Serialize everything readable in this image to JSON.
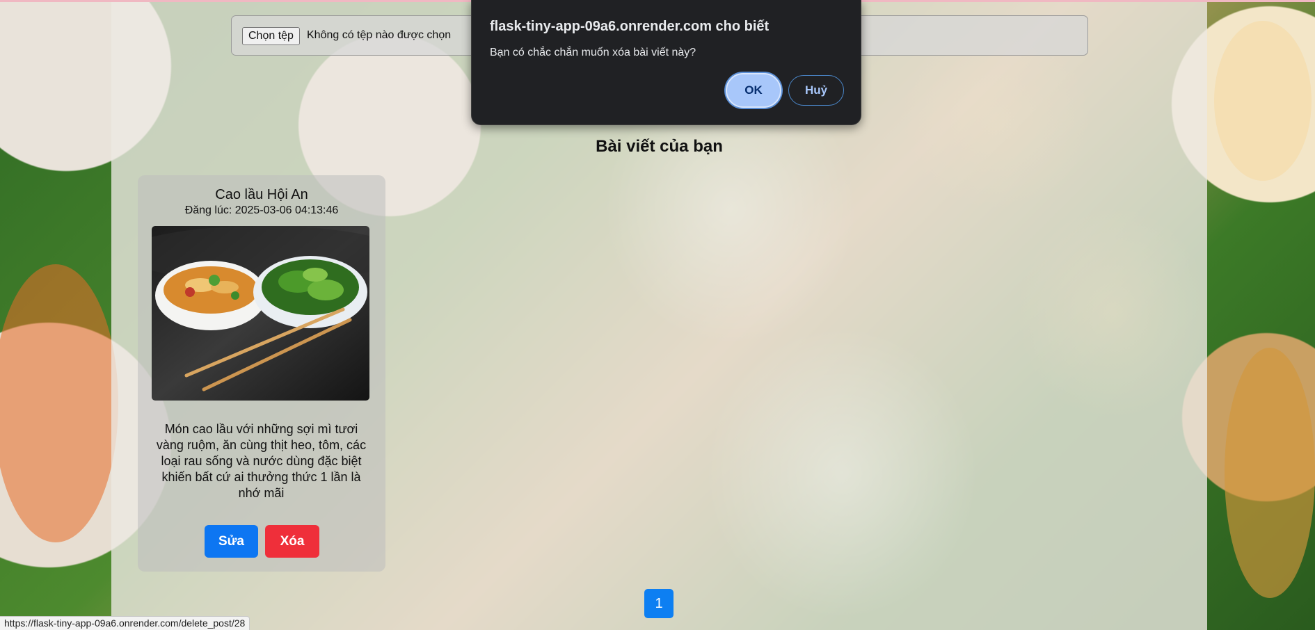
{
  "upload": {
    "button_label": "Chọn tệp",
    "status_text": "Không có tệp nào được chọn"
  },
  "section": {
    "title": "Bài viết của bạn"
  },
  "posts": [
    {
      "title": "Cao lầu Hội An",
      "date": "Đăng lúc: 2025-03-06 04:13:46",
      "body": "Món cao lầu với những sợi mì tươi vàng ruộm, ăn cùng thịt heo, tôm, các loại rau sống và nước dùng đặc biệt khiến bất cứ ai thưởng thức 1 lần là nhớ mãi",
      "edit_label": "Sửa",
      "delete_label": "Xóa"
    }
  ],
  "pagination": {
    "current_page": "1"
  },
  "status_bar": {
    "url": "https://flask-tiny-app-09a6.onrender.com/delete_post/28"
  },
  "dialog": {
    "title": "flask-tiny-app-09a6.onrender.com cho biết",
    "message": "Bạn có chắc chắn muốn xóa bài viết này?",
    "ok_label": "OK",
    "cancel_label": "Huỷ"
  },
  "colors": {
    "primary_blue": "#0d76f2",
    "danger_red": "#ef2f3a",
    "dialog_bg": "#202124",
    "dialog_accent": "#a8c7fa"
  }
}
